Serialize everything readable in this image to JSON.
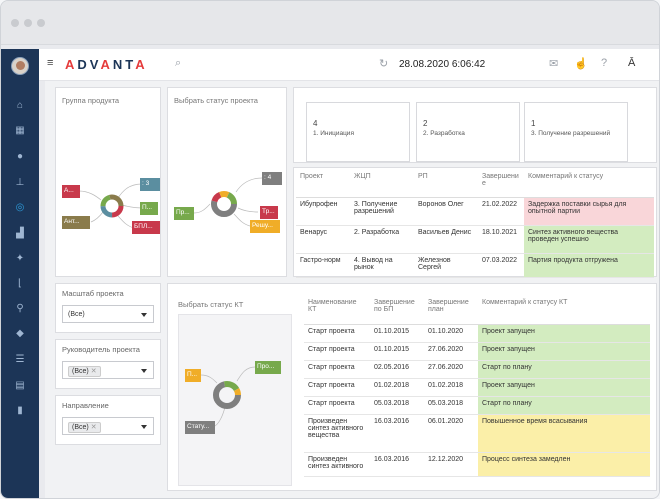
{
  "app": {
    "logo": "ADVANTA",
    "datetime": "28.08.2020 6:06:42"
  },
  "colors": {
    "sidebar": "#1c3557",
    "accent": "#2d9cdb",
    "red": "#c8394b",
    "olive": "#8a7b4b",
    "green": "#77a94c",
    "teal": "#5b8ea0",
    "gray": "#7f7f7f",
    "orange": "#f0ad28"
  },
  "sidebar": {
    "items": [
      "home-icon",
      "calendar-icon",
      "users-icon",
      "org-chart-icon",
      "donut-chart-icon",
      "bar-chart-icon",
      "sparkle-icon",
      "timeline-icon",
      "runner-icon",
      "cube-icon",
      "checklist-icon",
      "window-icon",
      "bookmark-icon"
    ]
  },
  "topbar": {
    "icons": [
      "menu-icon",
      "search-icon",
      "refresh-icon",
      "mail-icon",
      "like-icon",
      "help-icon",
      "user-menu-icon"
    ]
  },
  "panels": {
    "product_group": {
      "title": "Группа продукта",
      "nodes": [
        "А...",
        "Ант...",
        ": 3",
        "П...",
        "БПЛ..."
      ]
    },
    "project_status": {
      "title": "Выбрать статус проекта",
      "nodes": [
        "Пр...",
        ": 4",
        "Тр...",
        "Решу..."
      ]
    },
    "kt_status": {
      "title": "Выбрать статус КТ",
      "nodes": [
        "П...",
        "Про...",
        "Стату..."
      ]
    }
  },
  "kpis": [
    {
      "count": "4",
      "label": "1. Инициация"
    },
    {
      "count": "2",
      "label": "2. Разработка"
    },
    {
      "count": "1",
      "label": "3. Получение разрешений"
    }
  ],
  "projects": {
    "headers": [
      "Проект",
      "ЖЦП",
      "РП",
      "Завершение",
      "Комментарий к статусу"
    ],
    "rows": [
      {
        "project": "Ибупрофен",
        "stage": "3. Получение разрешений",
        "manager": "Воронов Олег",
        "end": "21.02.2022",
        "comment": "Задержка поставки сырья для опытной партии",
        "color": "pink"
      },
      {
        "project": "Венарус",
        "stage": "2. Разработка",
        "manager": "Васильев Денис",
        "end": "18.10.2021",
        "comment": "Синтез активного вещества проведен успешно",
        "color": "green"
      },
      {
        "project": "Гастро-норм",
        "stage": "4. Вывод на рынок",
        "manager": "Железнов Сергей",
        "end": "07.03.2022",
        "comment": "Партия продукта отгружена",
        "color": "green"
      }
    ]
  },
  "filters": [
    {
      "label": "Масштаб проекта",
      "value": "(Все)",
      "tag": false
    },
    {
      "label": "Руководитель проекта",
      "value": "(Все)",
      "tag": true
    },
    {
      "label": "Направление",
      "value": "(Все)",
      "tag": true
    }
  ],
  "milestones": {
    "headers": [
      "Наименование КТ",
      "Завершение по БП",
      "Завершение план",
      "Комментарий к статусу КТ"
    ],
    "rows": [
      {
        "name": "Старт проекта",
        "bp": "01.10.2015",
        "plan": "01.10.2020",
        "comment": "Проект запущен",
        "color": "green"
      },
      {
        "name": "Старт проекта",
        "bp": "01.10.2015",
        "plan": "27.06.2020",
        "comment": "Проект запущен",
        "color": "green"
      },
      {
        "name": "Старт проекта",
        "bp": "02.05.2016",
        "plan": "27.06.2020",
        "comment": "Старт по плану",
        "color": "green"
      },
      {
        "name": "Старт проекта",
        "bp": "01.02.2018",
        "plan": "01.02.2018",
        "comment": "Проект запущен",
        "color": "green"
      },
      {
        "name": "Старт проекта",
        "bp": "05.03.2018",
        "plan": "05.03.2018",
        "comment": "Старт по плану",
        "color": "green"
      },
      {
        "name": "Произведен синтез активного вещества",
        "bp": "16.03.2016",
        "plan": "06.01.2020",
        "comment": "Повышенное время всасывания",
        "color": "yellow"
      },
      {
        "name": "Произведен синтез активного",
        "bp": "16.03.2016",
        "plan": "12.12.2020",
        "comment": "Процесс синтеза замедлен",
        "color": "yellow"
      }
    ]
  }
}
